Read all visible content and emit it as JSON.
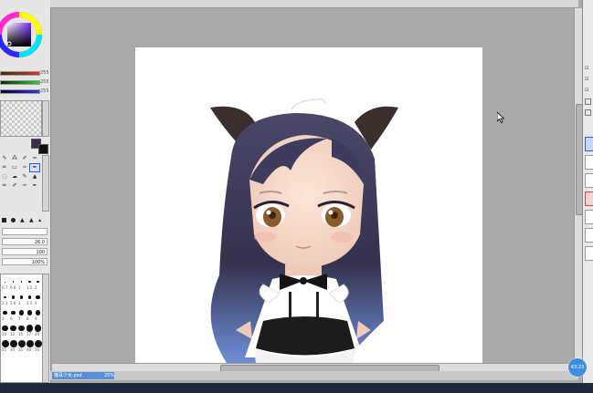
{
  "left_panel": {
    "slider_values": [
      "255",
      "255",
      "255"
    ],
    "opacity_value": "100%",
    "size_value": "26.0",
    "density_value": "100",
    "brush_labels": [
      "0.7",
      "0.8",
      "1",
      "1.5",
      "2",
      "2.3",
      "2.6",
      "3",
      "3.5",
      "4",
      "5",
      "6",
      "7",
      "8",
      "9",
      "10",
      "12",
      "15",
      "17",
      "20",
      "25",
      "30",
      "35",
      "40",
      "50"
    ]
  },
  "status": {
    "document_name": "猫耳少女.psd",
    "zoom": "25%"
  },
  "timer_badge": "43:23",
  "colors": {
    "canvas_bg": "#a9a9a9",
    "paper": "#ffffff",
    "hair": "#3e3c5c",
    "accent": "#3d8fe6"
  },
  "icons": [
    "color-wheel-icon",
    "cursor-arrow-icon",
    "timer-badge-icon"
  ]
}
